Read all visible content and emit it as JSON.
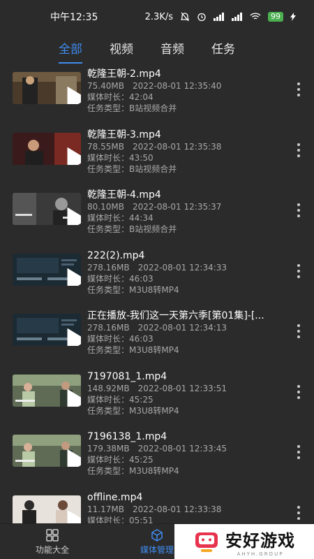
{
  "status": {
    "time": "中午12:35",
    "speed": "2.3K/s",
    "battery": "99"
  },
  "tabs": [
    {
      "label": "全部",
      "active": true
    },
    {
      "label": "视频",
      "active": false
    },
    {
      "label": "音频",
      "active": false
    },
    {
      "label": "任务",
      "active": false
    }
  ],
  "items": [
    {
      "title": "乾隆王朝-2.mp4",
      "size": "75.40MB",
      "date": "2022-08-01 12:35:40",
      "duration": "媒体时长：42:04",
      "type": "任务类型：B站视频合并",
      "thumb": "period"
    },
    {
      "title": "乾隆王朝-3.mp4",
      "size": "78.55MB",
      "date": "2022-08-01 12:35:38",
      "duration": "媒体时长：43:50",
      "type": "任务类型：B站视频合并",
      "thumb": "period-red"
    },
    {
      "title": "乾隆王朝-4.mp4",
      "size": "80.10MB",
      "date": "2022-08-01 12:35:37",
      "duration": "媒体时长：44:34",
      "type": "任务类型：B站视频合并",
      "thumb": "period-bw"
    },
    {
      "title": "222(2).mp4",
      "size": "278.16MB",
      "date": "2022-08-01 12:34:33",
      "duration": "媒体时长：46:03",
      "type": "任务类型：M3U8转MP4",
      "thumb": "screen"
    },
    {
      "title": "正在播放-我们这一天第六季[第01集]-[...",
      "size": "278.16MB",
      "date": "2022-08-01 12:34:13",
      "duration": "媒体时长：46:03",
      "type": "任务类型：M3U8转MP4",
      "thumb": "screen"
    },
    {
      "title": "7197081_1.mp4",
      "size": "148.92MB",
      "date": "2022-08-01 12:33:51",
      "duration": "媒体时长：45:25",
      "type": "任务类型：M3U8转MP4",
      "thumb": "street"
    },
    {
      "title": "7196138_1.mp4",
      "size": "179.38MB",
      "date": "2022-08-01 12:33:45",
      "duration": "媒体时长：45:25",
      "type": "任务类型：M3U8转MP4",
      "thumb": "street"
    },
    {
      "title": "offline.mp4",
      "size": "11.17MB",
      "date": "2022-08-01 12:33:38",
      "duration": "媒体时长：05:51",
      "type": "",
      "thumb": "people"
    }
  ],
  "nav": [
    {
      "label": "功能大全",
      "icon": "grid-icon",
      "active": false
    },
    {
      "label": "媒体管理",
      "icon": "cube-icon",
      "active": true
    }
  ],
  "watermark": {
    "text": "安好游戏",
    "sub": "AHYH.GROUP"
  },
  "colors": {
    "accent": "#3f8cf0",
    "background": "#2b2b2b",
    "secondary_text": "#a8a8a8"
  }
}
